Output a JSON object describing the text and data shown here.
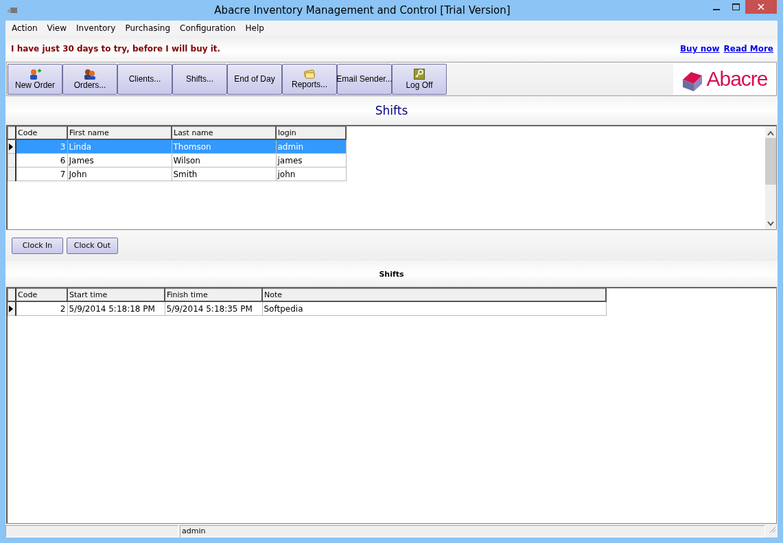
{
  "window": {
    "title": "Abacre Inventory Management and Control [Trial Version]"
  },
  "menu": [
    "Action",
    "View",
    "Inventory",
    "Purchasing",
    "Configuration",
    "Help"
  ],
  "banner": {
    "message": "I have just 30 days to try, before I will buy it.",
    "links": [
      "Buy now",
      "Read More"
    ]
  },
  "toolbar": [
    {
      "label": "New Order",
      "kind": "user-plus"
    },
    {
      "label": "Orders...",
      "kind": "users"
    },
    {
      "label": "Clients...",
      "kind": "plain"
    },
    {
      "label": "Shifts...",
      "kind": "plain"
    },
    {
      "label": "End of Day",
      "kind": "plain"
    },
    {
      "label": "Reports...",
      "kind": "papers"
    },
    {
      "label": "Email Sender...",
      "kind": "plain"
    },
    {
      "label": "Log Off",
      "kind": "key"
    }
  ],
  "logo": "Abacre",
  "page_title": "Shifts",
  "users_grid": {
    "columns": [
      "Code",
      "First name",
      "Last name",
      "login"
    ],
    "rows": [
      {
        "cells": [
          "3",
          "Linda",
          "Thomson",
          "admin"
        ],
        "selected": true
      },
      {
        "cells": [
          "6",
          "James",
          "Wilson",
          "james"
        ],
        "selected": false
      },
      {
        "cells": [
          "7",
          "John",
          "Smith",
          "john"
        ],
        "selected": false
      }
    ]
  },
  "actions": [
    "Clock In",
    "Clock Out"
  ],
  "shifts_title": "Shifts",
  "shifts_grid": {
    "columns": [
      "Code",
      "Start time",
      "Finish time",
      "Note"
    ],
    "rows": [
      {
        "cells": [
          "2",
          "5/9/2014 5:18:18 PM",
          "5/9/2014 5:18:35 PM",
          "Softpedia"
        ],
        "selected": true
      }
    ]
  },
  "status_bar": {
    "user": "admin"
  }
}
